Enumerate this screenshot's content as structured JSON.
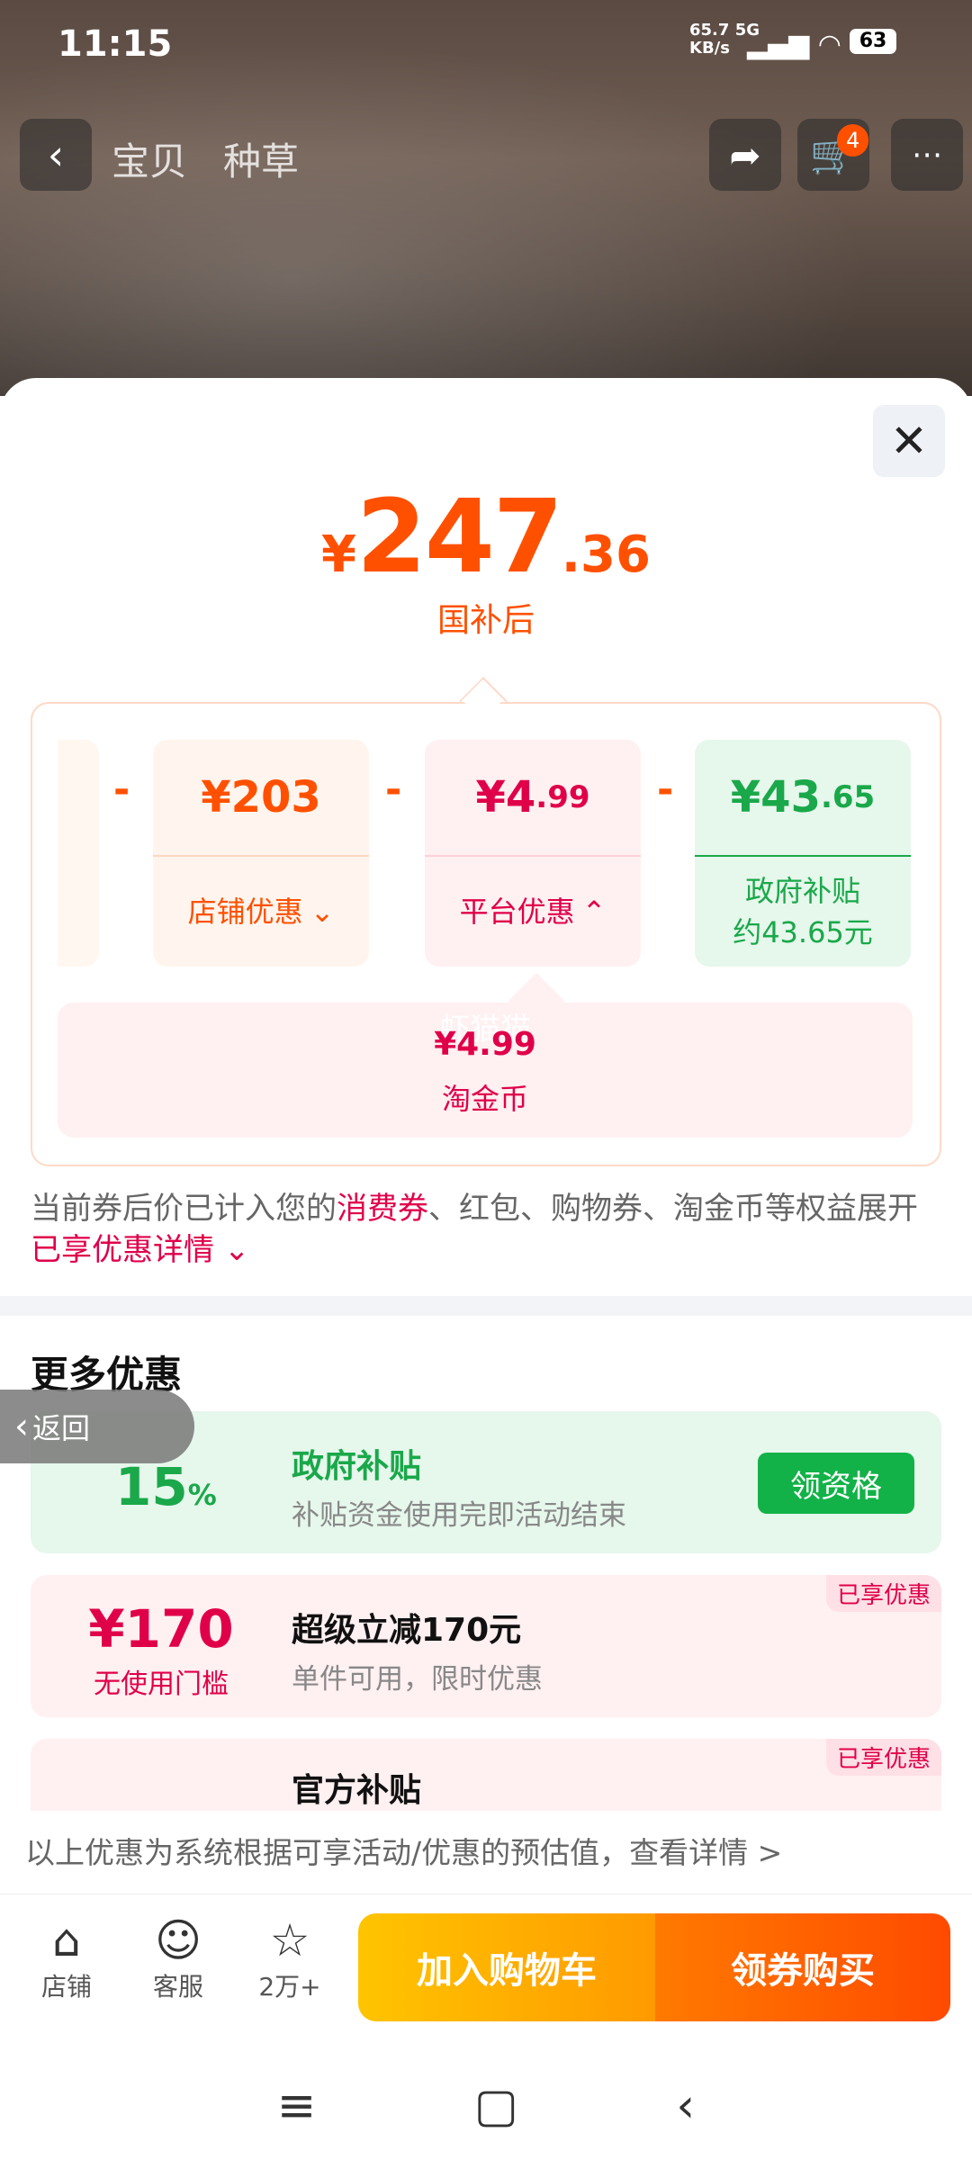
{
  "status": {
    "time": "11:15",
    "net_speed": "65.7",
    "net_unit": "KB/s",
    "network": "5G",
    "battery": "63"
  },
  "nav": {
    "tabs": [
      "宝贝",
      "种草"
    ],
    "cart_count": "4"
  },
  "price": {
    "currency": "¥",
    "integer": "247",
    "decimal": ".36",
    "label": "国补后"
  },
  "breakdown": {
    "cards": [
      {
        "amount_int": "¥203",
        "amount_dec": "",
        "label": "店铺优惠",
        "chevron": "chevron-down"
      },
      {
        "amount_int": "¥4",
        "amount_dec": ".99",
        "label": "平台优惠",
        "chevron": "chevron-up"
      },
      {
        "amount_int": "¥43",
        "amount_dec": ".65",
        "label": "政府补贴",
        "label2": "约43.65元"
      }
    ],
    "coin": {
      "amount": "¥4.99",
      "label": "淘金币",
      "watermark": "虾猫猫"
    }
  },
  "note": {
    "prefix": "当前券后价已计入您的",
    "highlight": "消费券",
    "middle": "、红包、购物券、淘金币等权益展开",
    "link": "已享优惠详情"
  },
  "more": {
    "title": "更多优惠",
    "back_label": "返回",
    "offers": [
      {
        "big": "15",
        "unit": "%",
        "title": "政府补贴",
        "sub": "补贴资金使用完即活动结束",
        "button": "领资格"
      },
      {
        "big": "¥170",
        "small": "无使用门槛",
        "title": "超级立减170元",
        "sub": "单件可用，限时优惠",
        "tag": "已享优惠"
      },
      {
        "title": "官方补贴",
        "tag": "已享优惠"
      }
    ]
  },
  "footer_note": "以上优惠为系统根据可享活动/优惠的预估值，查看详情 >",
  "actions": {
    "shop": "店铺",
    "service": "客服",
    "favorite": "2万+",
    "add_cart": "加入购物车",
    "buy": "领券购买"
  },
  "colors": {
    "accent": "#ff5000",
    "green": "#1aa84a",
    "pink": "#e0004a"
  }
}
